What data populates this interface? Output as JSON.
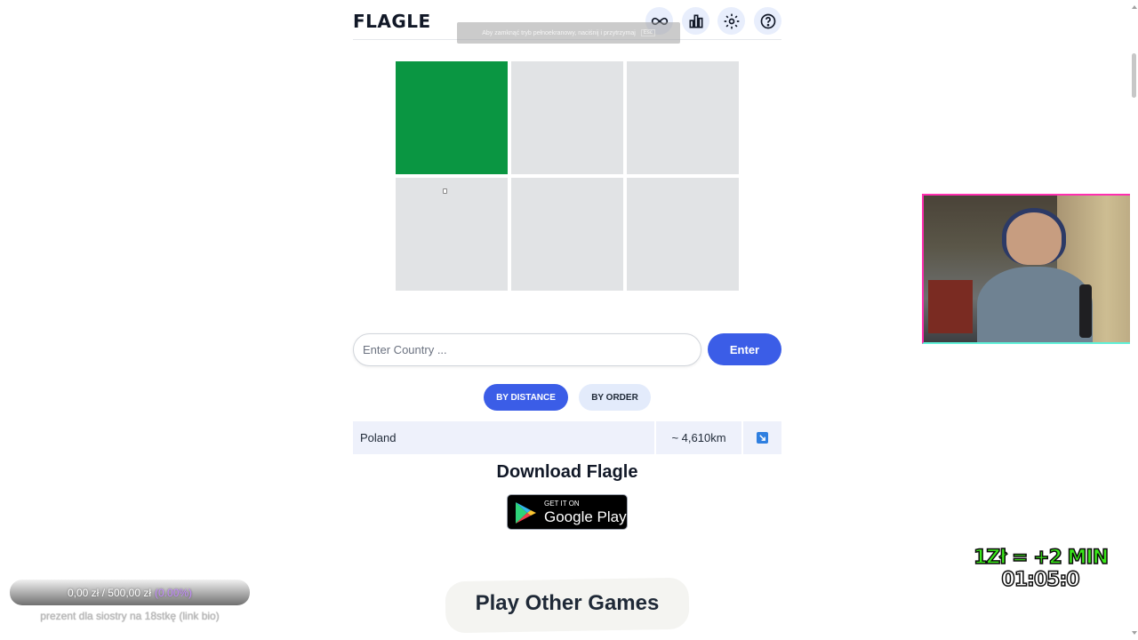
{
  "header": {
    "logo": "FLAGLE",
    "icons": [
      "infinity-icon",
      "stats-bar-icon",
      "gear-icon",
      "help-icon"
    ]
  },
  "fullscreen_notice": {
    "text": "Aby zamknąć tryb pełnoekranowy, naciśnij i przytrzymaj",
    "key": "Esc"
  },
  "puzzle": {
    "tiles_revealed": [
      true,
      false,
      false,
      false,
      false,
      false
    ],
    "revealed_color": "#0a9642",
    "hidden_color": "#e1e3e5"
  },
  "guess_input": {
    "placeholder": "Enter Country ...",
    "value": ""
  },
  "enter_button": {
    "label": "Enter"
  },
  "sort_toggle": {
    "by_distance": "BY DISTANCE",
    "by_order": "BY ORDER",
    "active": "by_distance"
  },
  "guesses": [
    {
      "country": "Poland",
      "distance": "~ 4,610km",
      "direction_icon": "arrow-down-right-icon"
    }
  ],
  "download": {
    "title": "Download Flagle",
    "store_small": "GET IT ON",
    "store_big": "Google Play"
  },
  "other_games": {
    "label": "Play Other Games"
  },
  "overlay": {
    "donation_progress": "0,00 zł / 500,00 zł",
    "donation_percent": "(0.00%)",
    "donation_note": "prezent dla siostry na 18stkę (link bio)",
    "subathon_rate": "1Zł = +2 MIN",
    "subathon_timer": "01:05:0"
  },
  "colors": {
    "accent": "#3b5de7",
    "pill_inactive": "#e3ebfb",
    "row_bg": "#eef1fb",
    "timer_green": "#39e819"
  }
}
